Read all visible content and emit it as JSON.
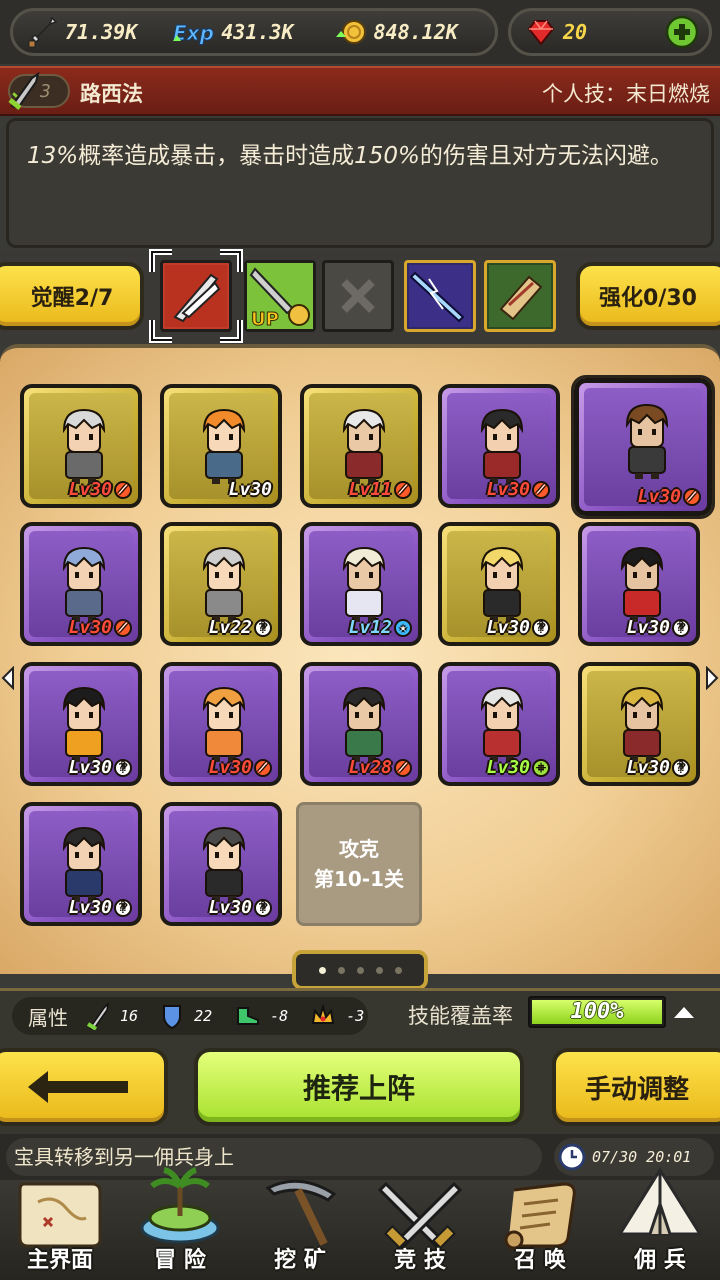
{
  "resources": {
    "attack": {
      "value": "71.39K",
      "icon": "sword-icon"
    },
    "exp": {
      "value": "431.3K",
      "icon": "exp-icon"
    },
    "gold": {
      "value": "848.12K",
      "icon": "coin-icon"
    },
    "gems": {
      "value": "20",
      "icon": "ruby-icon"
    }
  },
  "hero": {
    "grade": "3",
    "name": "路西法",
    "skill": "个人技：末日燃烧",
    "description_pre": "13%",
    "description_mid": "概率造成暴击，暴击时造成",
    "description_mid2": "150%",
    "description_post": "的伤害且对方无法闪避。"
  },
  "awaken": {
    "label": "觉醒2/7",
    "enhance_label": "强化0/30"
  },
  "skills": [
    {
      "name": "crossed-blades-skill",
      "state": "selected"
    },
    {
      "name": "sword-up-skill",
      "state": "normal"
    },
    {
      "name": "empty-slot",
      "state": "locked"
    },
    {
      "name": "lightning-sword-skill",
      "state": "normal"
    },
    {
      "name": "scroll-skill",
      "state": "normal"
    }
  ],
  "heroes": [
    {
      "lv": "Lv30",
      "rarity": "gold",
      "badge": "red",
      "lvcolor": "red"
    },
    {
      "lv": "Lv30",
      "rarity": "gold",
      "badge": "none",
      "lvcolor": "white"
    },
    {
      "lv": "Lv11",
      "rarity": "gold",
      "badge": "red",
      "lvcolor": "red"
    },
    {
      "lv": "Lv30",
      "rarity": "purple",
      "badge": "red",
      "lvcolor": "red"
    },
    {
      "lv": "Lv30",
      "rarity": "purple",
      "badge": "red",
      "lvcolor": "red",
      "selected": true
    },
    {
      "lv": "Lv30",
      "rarity": "purple",
      "badge": "red",
      "lvcolor": "red"
    },
    {
      "lv": "Lv22",
      "rarity": "gold",
      "badge": "white",
      "lvcolor": "white"
    },
    {
      "lv": "Lv12",
      "rarity": "purple",
      "badge": "blue",
      "lvcolor": "blue"
    },
    {
      "lv": "Lv30",
      "rarity": "gold",
      "badge": "white",
      "lvcolor": "white"
    },
    {
      "lv": "Lv30",
      "rarity": "purple",
      "badge": "white",
      "lvcolor": "white"
    },
    {
      "lv": "Lv30",
      "rarity": "purple",
      "badge": "white",
      "lvcolor": "white"
    },
    {
      "lv": "Lv30",
      "rarity": "purple",
      "badge": "red",
      "lvcolor": "red"
    },
    {
      "lv": "Lv28",
      "rarity": "purple",
      "badge": "red",
      "lvcolor": "red"
    },
    {
      "lv": "Lv30",
      "rarity": "purple",
      "badge": "green",
      "lvcolor": "green"
    },
    {
      "lv": "Lv30",
      "rarity": "gold",
      "badge": "white",
      "lvcolor": "white"
    },
    {
      "lv": "Lv30",
      "rarity": "purple",
      "badge": "white",
      "lvcolor": "white"
    },
    {
      "lv": "Lv30",
      "rarity": "purple",
      "badge": "white",
      "lvcolor": "white"
    }
  ],
  "locked_slot": {
    "line1": "攻克",
    "line2": "第10-1关"
  },
  "pager": {
    "pages": 5,
    "current": 1
  },
  "attributes": {
    "label": "属性",
    "values": [
      {
        "icon": "sword-attr-icon",
        "value": "16"
      },
      {
        "icon": "shield-attr-icon",
        "value": "22"
      },
      {
        "icon": "boot-attr-icon",
        "value": "-8"
      },
      {
        "icon": "crown-attr-icon",
        "value": "-3"
      }
    ],
    "coverage_label": "技能覆盖率",
    "coverage_value": "100%",
    "coverage_fraction": 1.0
  },
  "actions": {
    "recommend": "推荐上阵",
    "manual": "手动调整"
  },
  "ticker": {
    "text": "宝具转移到另一佣兵身上",
    "time": "07/30 20:01"
  },
  "nav": [
    {
      "label": "主界面",
      "icon": "map-icon"
    },
    {
      "label": "冒 险",
      "icon": "island-icon"
    },
    {
      "label": "挖 矿",
      "icon": "pickaxe-icon"
    },
    {
      "label": "竞 技",
      "icon": "crossed-swords-icon"
    },
    {
      "label": "召 唤",
      "icon": "scroll-icon"
    },
    {
      "label": "佣 兵",
      "icon": "tent-icon"
    }
  ]
}
